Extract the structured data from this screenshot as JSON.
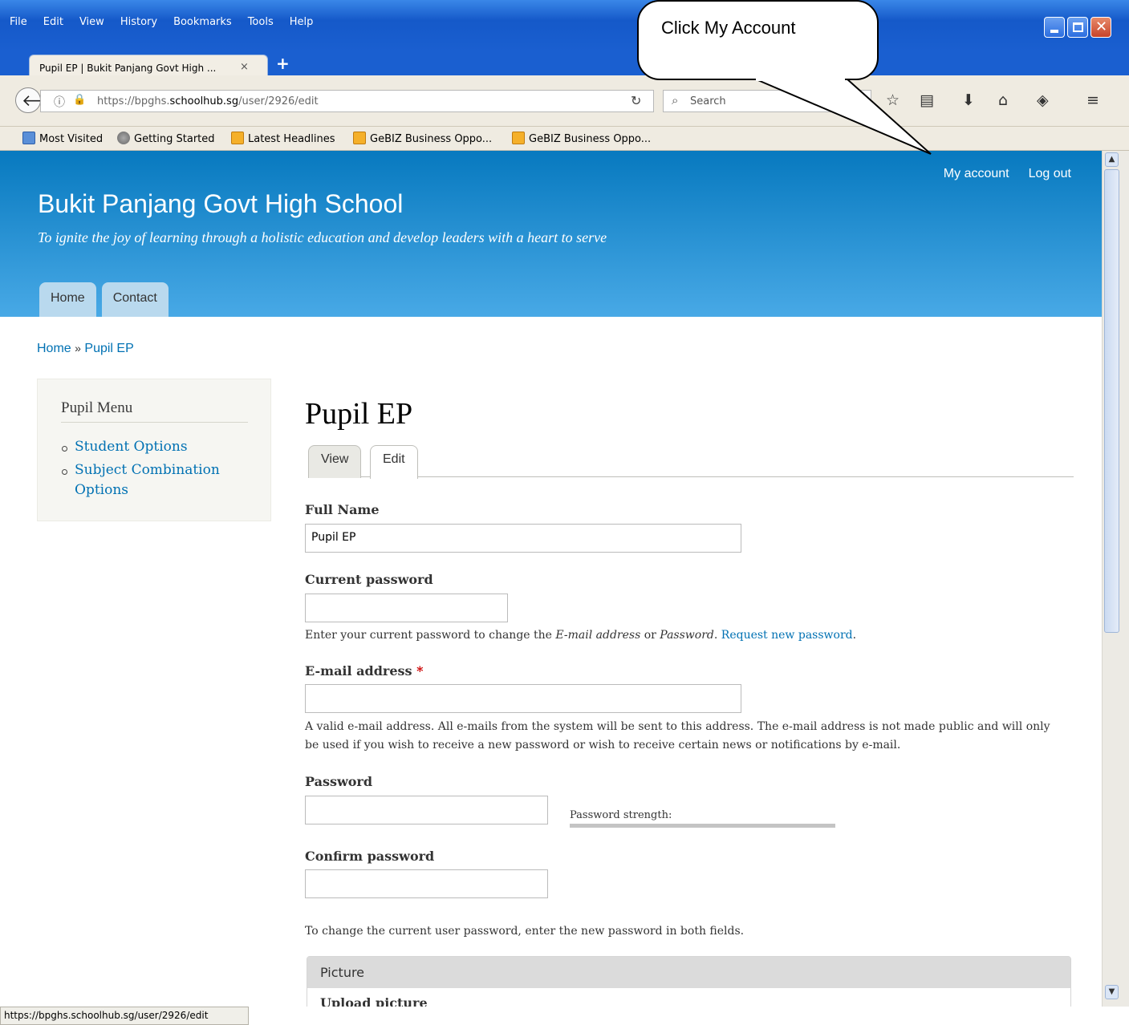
{
  "browser": {
    "menu": [
      "File",
      "Edit",
      "View",
      "History",
      "Bookmarks",
      "Tools",
      "Help"
    ],
    "tab_title": "Pupil EP | Bukit Panjang Govt High ...",
    "tab_close": "×",
    "new_tab": "+",
    "url_host": "https://bpghs.",
    "url_domain": "schoolhub.sg",
    "url_path": "/user/2926/edit",
    "search_placeholder": "Search",
    "bookmarks": [
      "Most Visited",
      "Getting Started",
      "Latest Headlines",
      "GeBIZ Business Oppo...",
      "GeBIZ Business Oppo..."
    ],
    "status_url": "https://bpghs.schoolhub.sg/user/2926/edit"
  },
  "callout": {
    "text": "Click My Account"
  },
  "site": {
    "name": "Bukit Panjang Govt High School",
    "slogan": "To ignite the joy of learning through a holistic education and develop leaders with a heart to serve",
    "secondary_menu": [
      "My account",
      "Log out"
    ],
    "main_menu": [
      "Home",
      "Contact"
    ]
  },
  "breadcrumb": {
    "home": "Home",
    "sep": "»",
    "current": "Pupil EP"
  },
  "sidebar": {
    "title": "Pupil Menu",
    "items": [
      "Student Options",
      "Subject Combination Options"
    ]
  },
  "content": {
    "title": "Pupil EP",
    "tabs": [
      "View",
      "Edit"
    ],
    "full_name_label": "Full Name",
    "full_name_value": "Pupil EP",
    "current_password_label": "Current password",
    "current_password_desc_1": "Enter your current password to change the ",
    "current_password_desc_em1": "E-mail address",
    "current_password_desc_2": " or ",
    "current_password_desc_em2": "Password",
    "current_password_desc_3": ". ",
    "request_new_password": "Request new password",
    "current_password_desc_4": ".",
    "email_label": "E-mail address ",
    "email_required": "*",
    "email_desc": "A valid e-mail address. All e-mails from the system will be sent to this address. The e-mail address is not made public and will only be used if you wish to receive a new password or wish to receive certain news or notifications by e-mail.",
    "password_label": "Password",
    "password_strength_label": "Password strength:",
    "password_strength_level": 0,
    "confirm_password_label": "Confirm password",
    "password_desc": "To change the current user password, enter the new password in both fields.",
    "picture_legend": "Picture",
    "upload_picture_label": "Upload picture"
  }
}
